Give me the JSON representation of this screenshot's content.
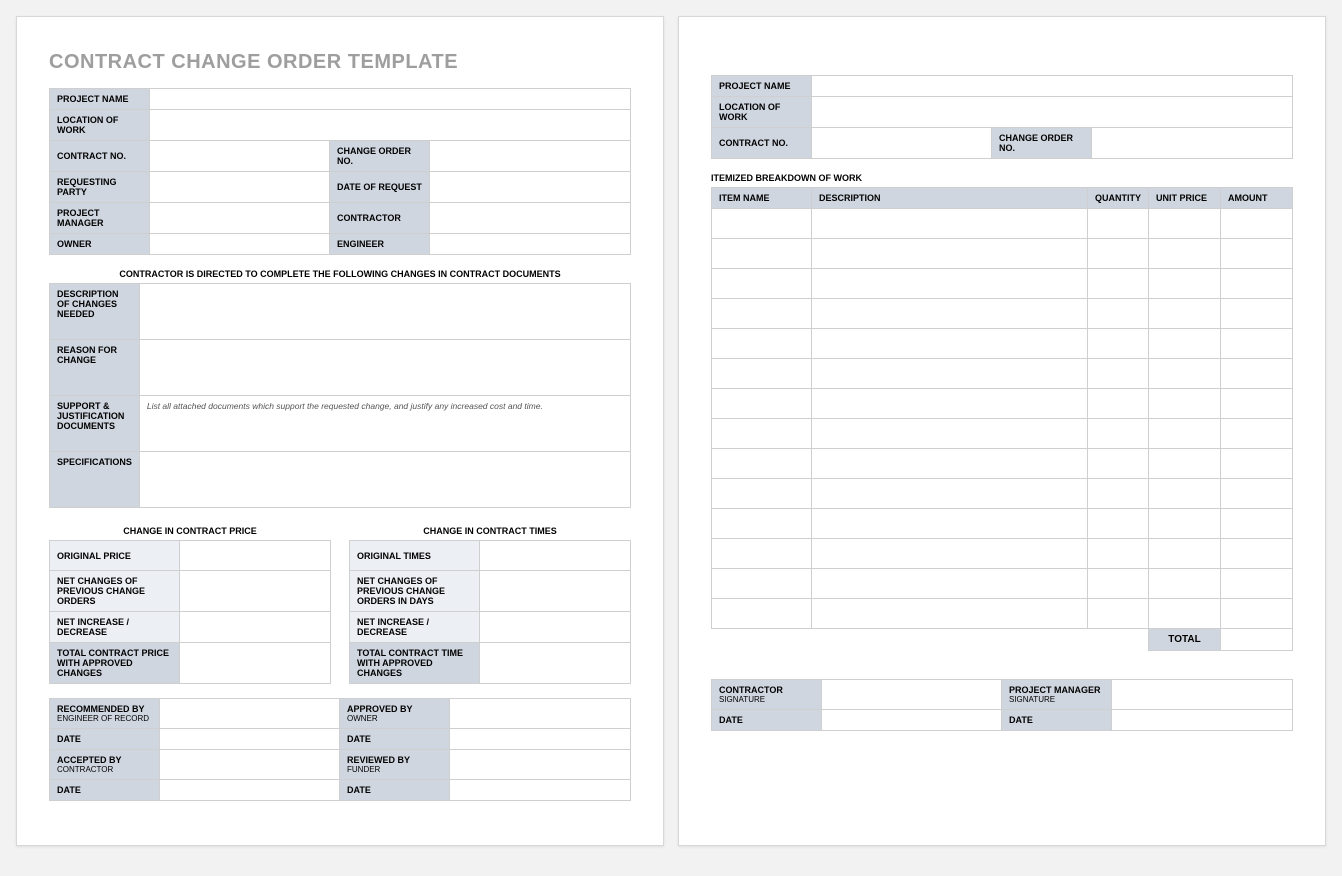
{
  "title": "CONTRACT CHANGE ORDER TEMPLATE",
  "page1": {
    "header": {
      "project_name": "PROJECT NAME",
      "location_of_work": "LOCATION OF WORK",
      "contract_no": "CONTRACT NO.",
      "change_order_no": "CHANGE ORDER NO.",
      "requesting_party": "REQUESTING PARTY",
      "date_of_request": "DATE OF REQUEST",
      "project_manager": "PROJECT MANAGER",
      "contractor": "CONTRACTOR",
      "owner": "OWNER",
      "engineer": "ENGINEER"
    },
    "directive": "CONTRACTOR IS DIRECTED TO COMPLETE THE FOLLOWING CHANGES IN CONTRACT DOCUMENTS",
    "changes": {
      "description_label": "DESCRIPTION OF CHANGES NEEDED",
      "reason_label": "REASON FOR CHANGE",
      "support_label": "SUPPORT & JUSTIFICATION DOCUMENTS",
      "support_hint": "List all attached documents which support the requested change, and justify any increased cost and time.",
      "specifications_label": "SPECIFICATIONS"
    },
    "price": {
      "caption": "CHANGE IN CONTRACT PRICE",
      "rows": {
        "original": "ORIGINAL PRICE",
        "net_previous": "NET CHANGES OF PREVIOUS CHANGE ORDERS",
        "net_inc": "NET INCREASE / DECREASE",
        "total": "TOTAL CONTRACT PRICE WITH APPROVED CHANGES"
      }
    },
    "times": {
      "caption": "CHANGE IN CONTRACT TIMES",
      "rows": {
        "original": "ORIGINAL TIMES",
        "net_previous": "NET CHANGES OF PREVIOUS CHANGE ORDERS IN DAYS",
        "net_inc": "NET INCREASE / DECREASE",
        "total": "TOTAL CONTRACT TIME WITH APPROVED CHANGES"
      }
    },
    "sign": {
      "recommended": "RECOMMENDED BY",
      "recommended_sub": "ENGINEER OF RECORD",
      "approved": "APPROVED BY",
      "approved_sub": "OWNER",
      "accepted": "ACCEPTED BY",
      "accepted_sub": "CONTRACTOR",
      "reviewed": "REVIEWED BY",
      "reviewed_sub": "FUNDER",
      "date": "DATE"
    }
  },
  "page2": {
    "header": {
      "project_name": "PROJECT NAME",
      "location_of_work": "LOCATION OF WORK",
      "contract_no": "CONTRACT NO.",
      "change_order_no": "CHANGE ORDER NO."
    },
    "breakdown_caption": "ITEMIZED BREAKDOWN OF WORK",
    "columns": {
      "item": "ITEM NAME",
      "desc": "DESCRIPTION",
      "qty": "QUANTITY",
      "price": "UNIT PRICE",
      "amount": "AMOUNT"
    },
    "row_count": 14,
    "total_label": "TOTAL",
    "sign": {
      "contractor": "CONTRACTOR",
      "contractor_sub": "SIGNATURE",
      "pm": "PROJECT MANAGER",
      "pm_sub": "SIGNATURE",
      "date": "DATE"
    }
  }
}
